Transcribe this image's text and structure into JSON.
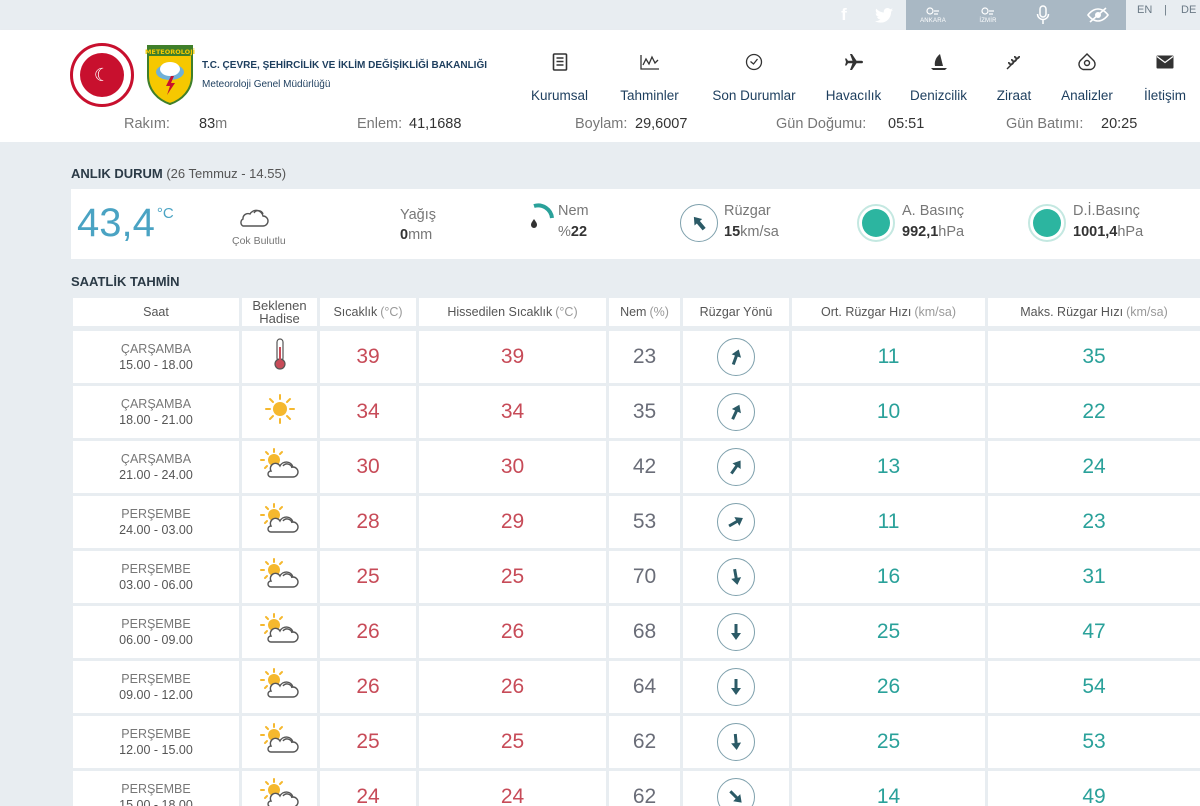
{
  "topbar": {
    "tools": [
      {
        "label": "ANKARA",
        "icon": "station-icon"
      },
      {
        "label": "İZMİR",
        "icon": "station-icon"
      },
      {
        "label": "",
        "icon": "microphone-icon"
      },
      {
        "label": "",
        "icon": "eye-slash-icon"
      }
    ],
    "lang_en": "EN",
    "lang_sep": "|",
    "lang_de": "DE"
  },
  "header": {
    "org_title": "T.C. ÇEVRE, ŞEHİRCİLİK VE İKLİM DEĞİŞİKLİĞİ BAKANLIĞI",
    "org_sub": "Meteoroloji Genel Müdürlüğü",
    "met_logo_text": "METEOROLOJİ",
    "nav": [
      {
        "label": "Kurumsal",
        "icon": "document-icon"
      },
      {
        "label": "Tahminler",
        "icon": "chart-icon"
      },
      {
        "label": "Son Durumlar",
        "icon": "check-circle-icon"
      },
      {
        "label": "Havacılık",
        "icon": "plane-icon"
      },
      {
        "label": "Denizcilik",
        "icon": "ship-icon"
      },
      {
        "label": "Ziraat",
        "icon": "wheat-icon"
      },
      {
        "label": "Analizler",
        "icon": "analysis-icon"
      },
      {
        "label": "İletişim",
        "icon": "envelope-icon"
      }
    ]
  },
  "station": {
    "rakim_label": "Rakım:",
    "rakim_value": "83",
    "rakim_unit": "m",
    "enlem_label": "Enlem:",
    "enlem_value": "41,1688",
    "boylam_label": "Boylam:",
    "boylam_value": "29,6007",
    "gundogumu_label": "Gün Doğumu:",
    "gundogumu_value": "05:51",
    "gunbatimi_label": "Gün Batımı:",
    "gunbatimi_value": "20:25"
  },
  "current": {
    "title": "ANLIK DURUM",
    "subtitle": "(26 Temmuz - 14.55)",
    "temperature": "43,4",
    "temperature_unit": "°C",
    "condition": "Çok Bulutlu",
    "rain_label": "Yağış",
    "rain_value": "0",
    "rain_unit": "mm",
    "humidity_label": "Nem",
    "humidity_prefix": "%",
    "humidity_value": "22",
    "wind_label": "Rüzgar",
    "wind_value": "15",
    "wind_unit": "km/sa",
    "pressure_label": "A. Basınç",
    "pressure_value": "992,1",
    "pressure_unit": "hPa",
    "sea_pressure_label": "D.İ.Basınç",
    "sea_pressure_value": "1001,4",
    "sea_pressure_unit": "hPa"
  },
  "hourly": {
    "title": "SAATLİK TAHMİN",
    "headers": {
      "time": "Saat",
      "event": "Beklenen Hadise",
      "temp": "Sıcaklık",
      "temp_unit": "(°C)",
      "feels": "Hissedilen Sıcaklık",
      "feels_unit": "(°C)",
      "humidity": "Nem",
      "humidity_unit": "(%)",
      "wind_dir": "Rüzgar Yönü",
      "wind_avg": "Ort. Rüzgar Hızı",
      "wind_avg_unit": "(km/sa)",
      "wind_max": "Maks. Rüzgar Hızı",
      "wind_max_unit": "(km/sa)"
    },
    "rows": [
      {
        "day": "ÇARŞAMBA",
        "time": "15.00 - 18.00",
        "icon": "thermometer-icon",
        "temp": "39",
        "feels": "39",
        "humidity": "23",
        "wind_dir_deg": 20,
        "wind_avg": "11",
        "wind_max": "35"
      },
      {
        "day": "ÇARŞAMBA",
        "time": "18.00 - 21.00",
        "icon": "sun-icon",
        "temp": "34",
        "feels": "34",
        "humidity": "35",
        "wind_dir_deg": 25,
        "wind_avg": "10",
        "wind_max": "22"
      },
      {
        "day": "ÇARŞAMBA",
        "time": "21.00 - 24.00",
        "icon": "partly-cloudy-icon",
        "temp": "30",
        "feels": "30",
        "humidity": "42",
        "wind_dir_deg": 35,
        "wind_avg": "13",
        "wind_max": "24"
      },
      {
        "day": "PERŞEMBE",
        "time": "24.00 - 03.00",
        "icon": "partly-cloudy-icon",
        "temp": "28",
        "feels": "29",
        "humidity": "53",
        "wind_dir_deg": 60,
        "wind_avg": "11",
        "wind_max": "23"
      },
      {
        "day": "PERŞEMBE",
        "time": "03.00 - 06.00",
        "icon": "partly-cloudy-icon",
        "temp": "25",
        "feels": "25",
        "humidity": "70",
        "wind_dir_deg": 170,
        "wind_avg": "16",
        "wind_max": "31"
      },
      {
        "day": "PERŞEMBE",
        "time": "06.00 - 09.00",
        "icon": "partly-cloudy-icon",
        "temp": "26",
        "feels": "26",
        "humidity": "68",
        "wind_dir_deg": 180,
        "wind_avg": "25",
        "wind_max": "47"
      },
      {
        "day": "PERŞEMBE",
        "time": "09.00 - 12.00",
        "icon": "partly-cloudy-icon",
        "temp": "26",
        "feels": "26",
        "humidity": "64",
        "wind_dir_deg": 180,
        "wind_avg": "26",
        "wind_max": "54"
      },
      {
        "day": "PERŞEMBE",
        "time": "12.00 - 15.00",
        "icon": "partly-cloudy-icon",
        "temp": "25",
        "feels": "25",
        "humidity": "62",
        "wind_dir_deg": 175,
        "wind_avg": "25",
        "wind_max": "53"
      },
      {
        "day": "PERŞEMBE",
        "time": "15.00 - 18.00",
        "icon": "partly-cloudy-icon",
        "temp": "24",
        "feels": "24",
        "humidity": "62",
        "wind_dir_deg": 135,
        "wind_avg": "14",
        "wind_max": "49"
      }
    ]
  }
}
